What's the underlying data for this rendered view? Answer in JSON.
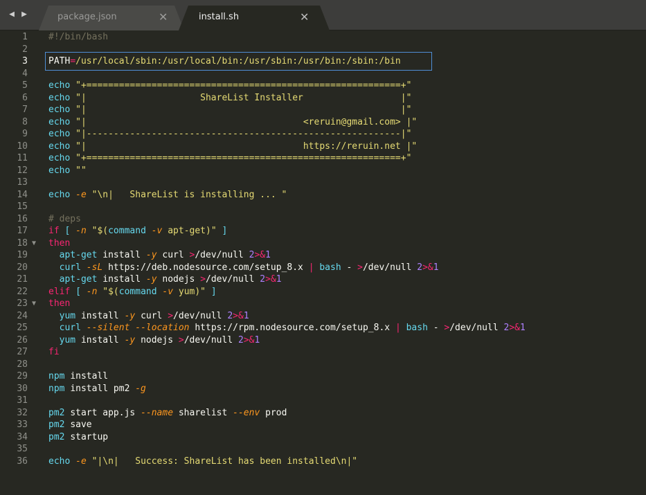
{
  "tabs": [
    {
      "label": "package.json",
      "active": false
    },
    {
      "label": "install.sh",
      "active": true
    }
  ],
  "nav": {
    "back": "◀",
    "forward": "▶"
  },
  "close_glyph": "✕",
  "fold_glyph": "▼",
  "current_line": 3,
  "fold_lines": [
    18,
    23
  ],
  "lines": [
    [
      {
        "t": "#!/bin/bash",
        "c": "m"
      }
    ],
    [],
    [
      {
        "t": "PATH",
        "c": "w"
      },
      {
        "t": "=",
        "c": "o"
      },
      {
        "t": "/usr/local/sbin:/usr/local/bin:/usr/sbin:/usr/bin:/sbin:/bin",
        "c": "s"
      }
    ],
    [],
    [
      {
        "t": "echo ",
        "c": "c"
      },
      {
        "t": "\"+==========================================================+\"",
        "c": "s"
      }
    ],
    [
      {
        "t": "echo ",
        "c": "c"
      },
      {
        "t": "\"|                     ShareList Installer                  |\"",
        "c": "s"
      }
    ],
    [
      {
        "t": "echo ",
        "c": "c"
      },
      {
        "t": "\"|                                                          |\"",
        "c": "s"
      }
    ],
    [
      {
        "t": "echo ",
        "c": "c"
      },
      {
        "t": "\"|                                        <reruin@gmail.com> |\"",
        "c": "s"
      }
    ],
    [
      {
        "t": "echo ",
        "c": "c"
      },
      {
        "t": "\"|----------------------------------------------------------|\"",
        "c": "s"
      }
    ],
    [
      {
        "t": "echo ",
        "c": "c"
      },
      {
        "t": "\"|                                        https://reruin.net |\"",
        "c": "s"
      }
    ],
    [
      {
        "t": "echo ",
        "c": "c"
      },
      {
        "t": "\"+==========================================================+\"",
        "c": "s"
      }
    ],
    [
      {
        "t": "echo ",
        "c": "c"
      },
      {
        "t": "\"\"",
        "c": "s"
      }
    ],
    [],
    [
      {
        "t": "echo ",
        "c": "c"
      },
      {
        "t": "-e ",
        "c": "f"
      },
      {
        "t": "\"\\n|   ShareList is installing ... \"",
        "c": "s"
      }
    ],
    [],
    [
      {
        "t": "# deps",
        "c": "m"
      }
    ],
    [
      {
        "t": "if ",
        "c": "k"
      },
      {
        "t": "[ ",
        "c": "c"
      },
      {
        "t": "-n ",
        "c": "f"
      },
      {
        "t": "\"$(",
        "c": "s"
      },
      {
        "t": "command ",
        "c": "c"
      },
      {
        "t": "-v ",
        "c": "f"
      },
      {
        "t": "apt-get)\"",
        "c": "s"
      },
      {
        "t": " ]",
        "c": "c"
      }
    ],
    [
      {
        "t": "then",
        "c": "k"
      }
    ],
    [
      {
        "t": "  apt-get ",
        "c": "c"
      },
      {
        "t": "install ",
        "c": "w"
      },
      {
        "t": "-y ",
        "c": "f"
      },
      {
        "t": "curl ",
        "c": "w"
      },
      {
        "t": ">",
        "c": "o"
      },
      {
        "t": "/dev/null ",
        "c": "w"
      },
      {
        "t": "2",
        "c": "n"
      },
      {
        "t": ">&",
        "c": "o"
      },
      {
        "t": "1",
        "c": "n"
      }
    ],
    [
      {
        "t": "  curl ",
        "c": "c"
      },
      {
        "t": "-sL ",
        "c": "f"
      },
      {
        "t": "https://deb.nodesource.com/setup_8.x ",
        "c": "w"
      },
      {
        "t": "| ",
        "c": "o"
      },
      {
        "t": "bash ",
        "c": "c"
      },
      {
        "t": "- ",
        "c": "w"
      },
      {
        "t": ">",
        "c": "o"
      },
      {
        "t": "/dev/null ",
        "c": "w"
      },
      {
        "t": "2",
        "c": "n"
      },
      {
        "t": ">&",
        "c": "o"
      },
      {
        "t": "1",
        "c": "n"
      }
    ],
    [
      {
        "t": "  apt-get ",
        "c": "c"
      },
      {
        "t": "install ",
        "c": "w"
      },
      {
        "t": "-y ",
        "c": "f"
      },
      {
        "t": "nodejs ",
        "c": "w"
      },
      {
        "t": ">",
        "c": "o"
      },
      {
        "t": "/dev/null ",
        "c": "w"
      },
      {
        "t": "2",
        "c": "n"
      },
      {
        "t": ">&",
        "c": "o"
      },
      {
        "t": "1",
        "c": "n"
      }
    ],
    [
      {
        "t": "elif ",
        "c": "k"
      },
      {
        "t": "[ ",
        "c": "c"
      },
      {
        "t": "-n ",
        "c": "f"
      },
      {
        "t": "\"$(",
        "c": "s"
      },
      {
        "t": "command ",
        "c": "c"
      },
      {
        "t": "-v ",
        "c": "f"
      },
      {
        "t": "yum)\"",
        "c": "s"
      },
      {
        "t": " ]",
        "c": "c"
      }
    ],
    [
      {
        "t": "then",
        "c": "k"
      }
    ],
    [
      {
        "t": "  yum ",
        "c": "c"
      },
      {
        "t": "install ",
        "c": "w"
      },
      {
        "t": "-y ",
        "c": "f"
      },
      {
        "t": "curl ",
        "c": "w"
      },
      {
        "t": ">",
        "c": "o"
      },
      {
        "t": "/dev/null ",
        "c": "w"
      },
      {
        "t": "2",
        "c": "n"
      },
      {
        "t": ">&",
        "c": "o"
      },
      {
        "t": "1",
        "c": "n"
      }
    ],
    [
      {
        "t": "  curl ",
        "c": "c"
      },
      {
        "t": "--silent --location ",
        "c": "f"
      },
      {
        "t": "https://rpm.nodesource.com/setup_8.x ",
        "c": "w"
      },
      {
        "t": "| ",
        "c": "o"
      },
      {
        "t": "bash ",
        "c": "c"
      },
      {
        "t": "- ",
        "c": "w"
      },
      {
        "t": ">",
        "c": "o"
      },
      {
        "t": "/dev/null ",
        "c": "w"
      },
      {
        "t": "2",
        "c": "n"
      },
      {
        "t": ">&",
        "c": "o"
      },
      {
        "t": "1",
        "c": "n"
      }
    ],
    [
      {
        "t": "  yum ",
        "c": "c"
      },
      {
        "t": "install ",
        "c": "w"
      },
      {
        "t": "-y ",
        "c": "f"
      },
      {
        "t": "nodejs ",
        "c": "w"
      },
      {
        "t": ">",
        "c": "o"
      },
      {
        "t": "/dev/null ",
        "c": "w"
      },
      {
        "t": "2",
        "c": "n"
      },
      {
        "t": ">&",
        "c": "o"
      },
      {
        "t": "1",
        "c": "n"
      }
    ],
    [
      {
        "t": "fi",
        "c": "k"
      }
    ],
    [],
    [
      {
        "t": "npm ",
        "c": "c"
      },
      {
        "t": "install",
        "c": "w"
      }
    ],
    [
      {
        "t": "npm ",
        "c": "c"
      },
      {
        "t": "install pm2 ",
        "c": "w"
      },
      {
        "t": "-g",
        "c": "f"
      }
    ],
    [],
    [
      {
        "t": "pm2 ",
        "c": "c"
      },
      {
        "t": "start app.js ",
        "c": "w"
      },
      {
        "t": "--name ",
        "c": "f"
      },
      {
        "t": "sharelist ",
        "c": "w"
      },
      {
        "t": "--env ",
        "c": "f"
      },
      {
        "t": "prod",
        "c": "w"
      }
    ],
    [
      {
        "t": "pm2 ",
        "c": "c"
      },
      {
        "t": "save",
        "c": "w"
      }
    ],
    [
      {
        "t": "pm2 ",
        "c": "c"
      },
      {
        "t": "startup",
        "c": "w"
      }
    ],
    [],
    [
      {
        "t": "echo ",
        "c": "c"
      },
      {
        "t": "-e ",
        "c": "f"
      },
      {
        "t": "\"|\\n|   Success: ShareList has been installed\\n|\"",
        "c": "s"
      }
    ]
  ],
  "colors": {
    "background": "#272822",
    "keyword": "#f92672",
    "command": "#66d9ef",
    "string": "#e6db74",
    "flag": "#fd971f",
    "comment": "#75715e",
    "number": "#ae81ff",
    "selection_border": "#4f8fd6"
  }
}
